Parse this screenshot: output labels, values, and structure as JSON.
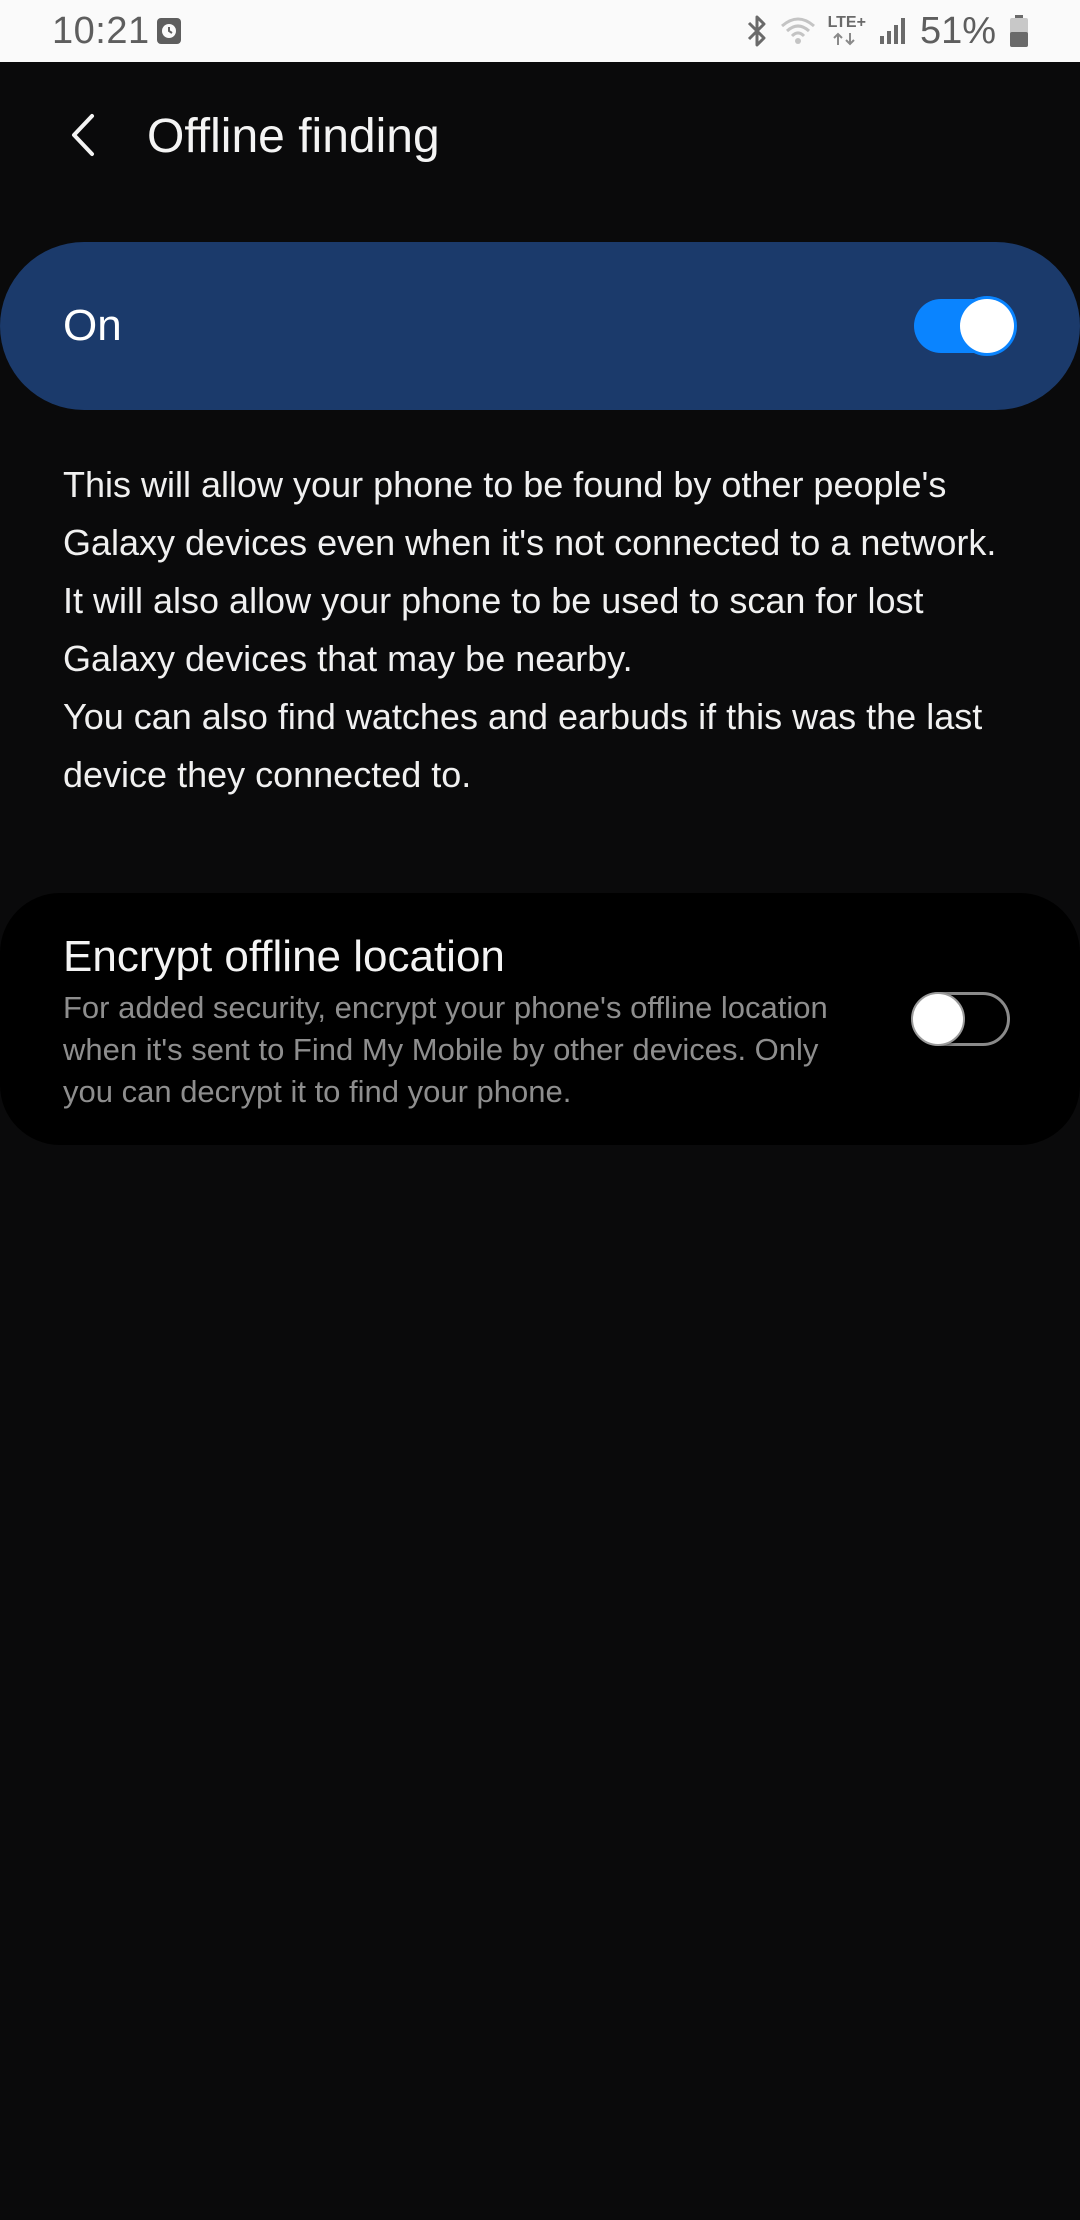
{
  "status_bar": {
    "time": "10:21",
    "network": "LTE+",
    "battery": "51%",
    "icons": [
      "clock-icon",
      "bluetooth-icon",
      "wifi-icon",
      "lte-data-icon",
      "signal-icon",
      "battery-icon"
    ]
  },
  "header": {
    "title": "Offline finding",
    "back_icon": "chevron-left-icon"
  },
  "master_switch": {
    "label": "On",
    "state": true,
    "color": "#1b3a6b"
  },
  "description": {
    "paragraph1": "This will allow your phone to be found by other people's Galaxy devices even when it's not connected to a network. It will also allow your phone to be used to scan for lost Galaxy devices that may be nearby.",
    "paragraph2": "You can also find watches and earbuds if this was the last device they connected to."
  },
  "encrypt_setting": {
    "title": "Encrypt offline location",
    "summary": "For added security, encrypt your phone's offline location when it's sent to Find My Mobile by other devices. Only you can decrypt it to find your phone.",
    "state": false
  },
  "colors": {
    "background": "#0a0a0b",
    "accent": "#0a84ff",
    "status_bar": "#fafafa"
  }
}
